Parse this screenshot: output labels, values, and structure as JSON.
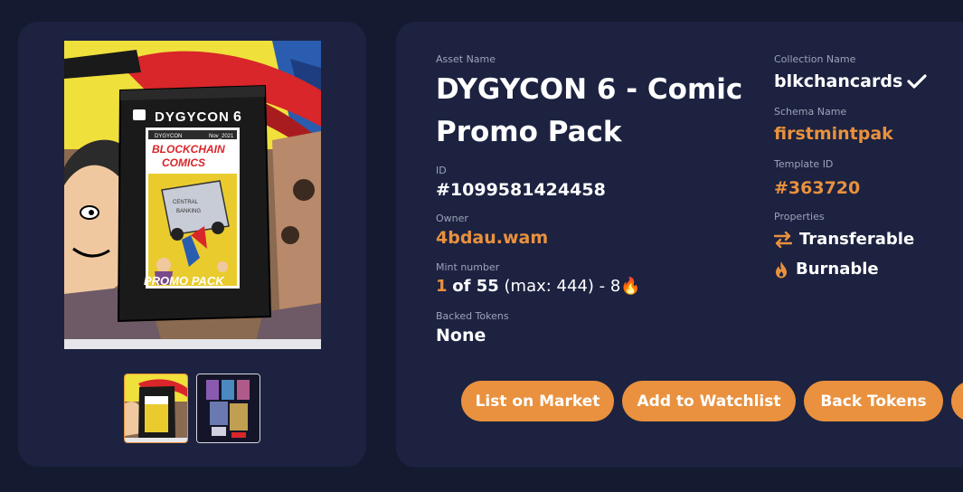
{
  "asset": {
    "name_label": "Asset Name",
    "name": "DYGYCON 6 - Comic Promo Pack",
    "id_label": "ID",
    "id": "#1099581424458",
    "owner_label": "Owner",
    "owner": "4bdau.wam",
    "mint_label": "Mint number",
    "mint_number": "1",
    "mint_of": "of 55",
    "mint_rest": "(max: 444) - 8🔥",
    "backed_label": "Backed Tokens",
    "backed": "None"
  },
  "collection": {
    "collection_label": "Collection Name",
    "collection": "blkchancards",
    "schema_label": "Schema Name",
    "schema": "firstmintpak",
    "template_label": "Template ID",
    "template": "#363720",
    "properties_label": "Properties",
    "properties": [
      {
        "icon": "transfer-arrows-icon",
        "label": "Transferable"
      },
      {
        "icon": "flame-icon",
        "label": "Burnable"
      }
    ]
  },
  "image": {
    "pack_brand": "DYGYCON",
    "pack_brand_num": "6",
    "pack_subbrand": "DYGYCON",
    "pack_date": "Nov_2021",
    "comic_line1": "BLOCKCHAIN",
    "comic_line2": "COMICS",
    "pack_footer": "PROMO PACK",
    "truck_text1": "CENTRAL",
    "truck_text2": "BANKING"
  },
  "actions": {
    "list": "List on Market",
    "watch": "Add to Watchlist",
    "back": "Back Tokens"
  },
  "colors": {
    "accent": "#e9913e",
    "card": "#1c2240",
    "background": "#141a30"
  }
}
